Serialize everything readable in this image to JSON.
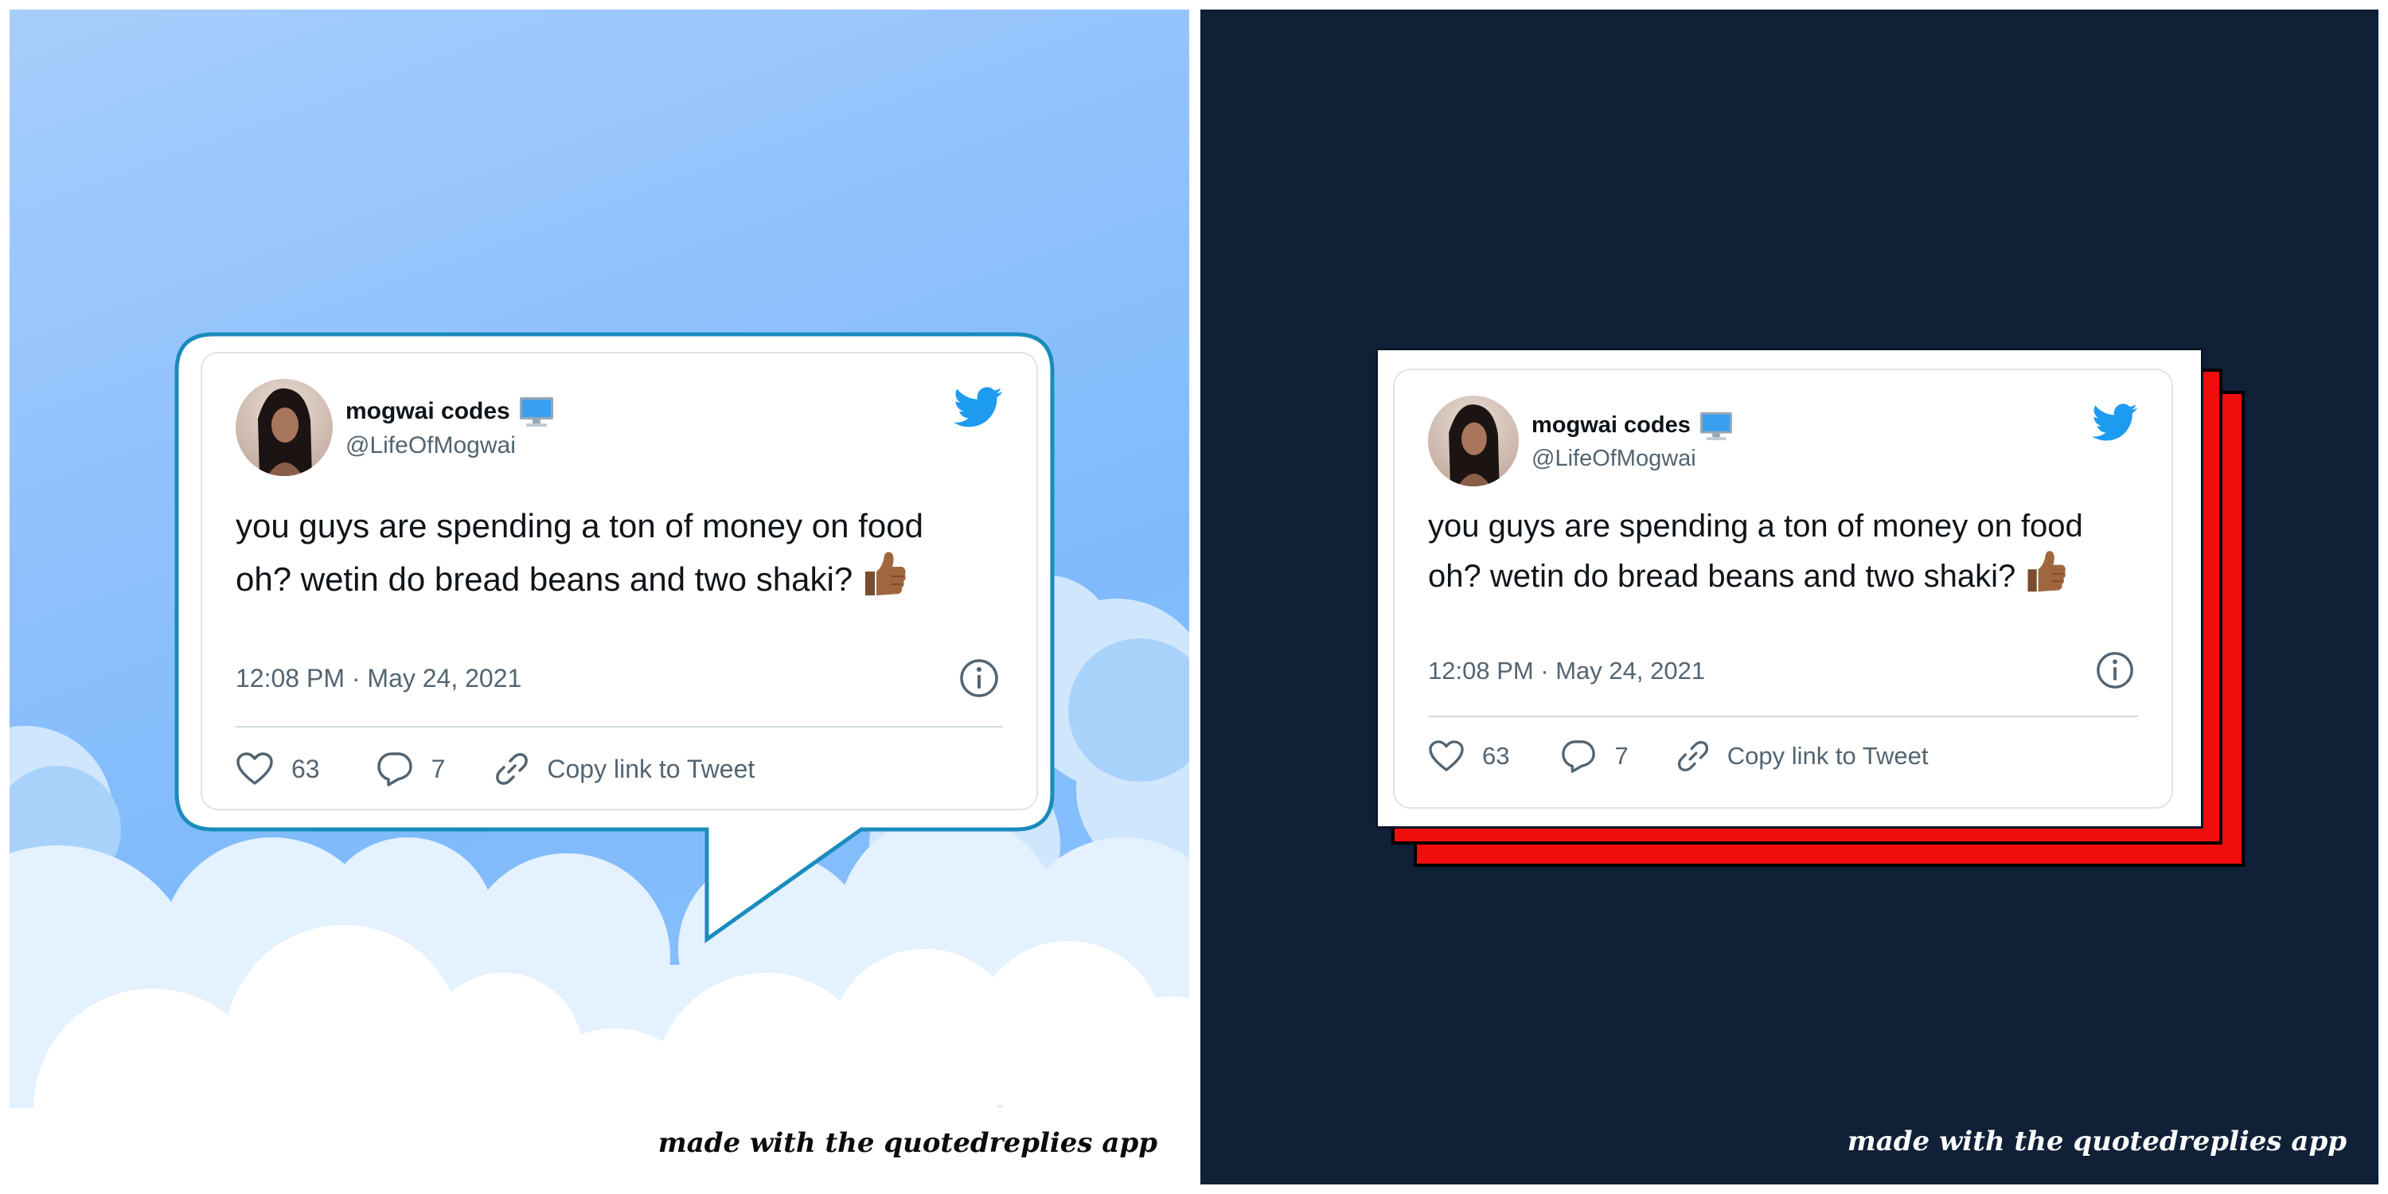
{
  "tweets": [
    {
      "display_name": "mogwai codes",
      "name_emoji_icon": "computer-monitor-icon",
      "handle": "@LifeOfMogwai",
      "text": "you guys are spending a ton of money on food oh? wetin do bread beans and two shaki?",
      "text_emoji_icon": "thumbs-up-icon",
      "timestamp": "12:08 PM · May 24, 2021",
      "likes": "63",
      "replies": "7",
      "copy_link_label": "Copy link to Tweet"
    }
  ],
  "watermark": "made with the quotedreplies app",
  "colors": {
    "left_sky": "#86bdfc",
    "left_clouds": "#ffffff",
    "bubble_border": "#1a8bbd",
    "right_background": "#0f2037",
    "red_layers": "#f20d0d",
    "twitter_blue": "#1d9bf0",
    "text_secondary": "#536471"
  },
  "icons": [
    "twitter-bird-icon",
    "info-icon",
    "heart-icon",
    "reply-bubble-icon",
    "link-icon"
  ]
}
